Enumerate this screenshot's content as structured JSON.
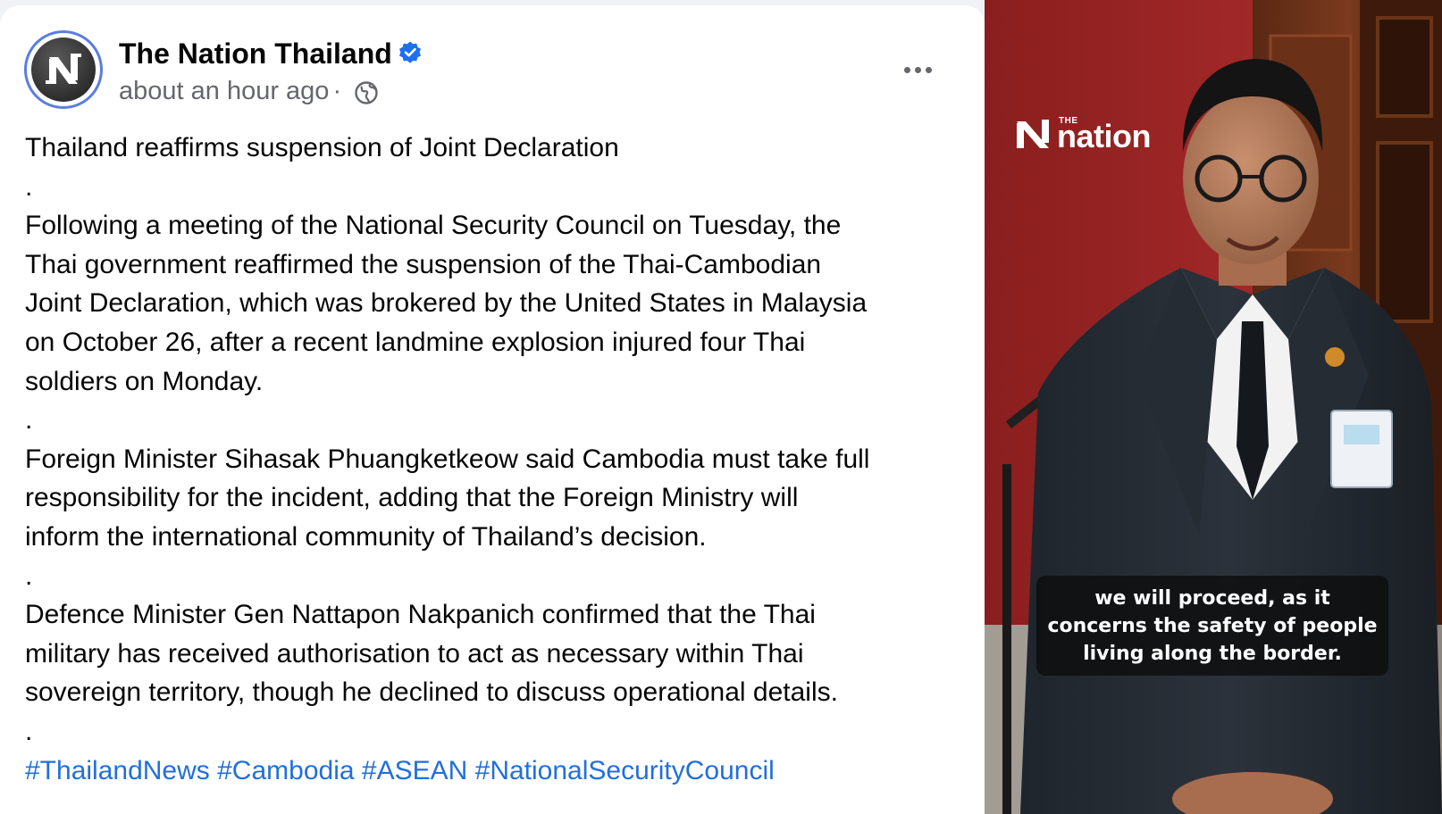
{
  "post": {
    "page_name": "The Nation Thailand",
    "verified": true,
    "timestamp": "about an hour ago",
    "separator": "·",
    "audience_icon": "globe-icon",
    "more_icon": "more-options-icon",
    "paragraphs": [
      "Thailand reaffirms suspension of Joint Declaration\n.",
      "Following a meeting of the National Security Council on Tuesday, the\nThai government reaffirmed the suspension of the Thai-Cambodian\nJoint Declaration, which was brokered by the United States in Malaysia\non October 26, after a recent landmine explosion injured four Thai\nsoldiers on Monday.\n.",
      "Foreign Minister Sihasak Phuangketkeow said Cambodia must take full\nresponsibility for the incident, adding that the Foreign Ministry will\ninform the international community of Thailand’s decision.\n.",
      "Defence Minister Gen Nattapon Nakpanich confirmed that the Thai\nmilitary has received authorisation to act as necessary within Thai\nsovereign territory, though he declined to discuss operational details.\n."
    ],
    "hashtags": [
      "#ThailandNews",
      "#Cambodia",
      "#ASEAN",
      "#NationalSecurityCouncil"
    ]
  },
  "video": {
    "logo_small": "THE",
    "logo_main": "nation",
    "caption": "we will proceed, as it\nconcerns the safety of people\nliving along the border."
  },
  "colors": {
    "page_name": "#050505",
    "meta": "#65676b",
    "hashtag": "#216fdb",
    "verified_badge": "#1d6ff2",
    "avatar_ring": "#5b7de3",
    "video_wall": "#8d2020"
  }
}
